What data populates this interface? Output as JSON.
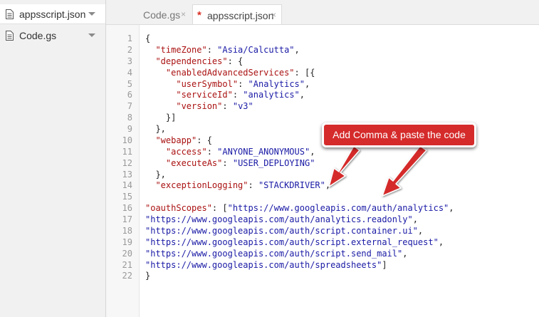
{
  "sidebar": {
    "items": [
      {
        "label": "appsscript.json",
        "icon": "file-icon"
      },
      {
        "label": "Code.gs",
        "icon": "file-icon"
      }
    ]
  },
  "tabs": [
    {
      "label": "Code.gs",
      "close": "×"
    },
    {
      "label": "appsscript.json",
      "close": "×",
      "modified_marker": "*"
    }
  ],
  "editor": {
    "lines": [
      {
        "n": "1",
        "segments": [
          {
            "t": "{",
            "c": "p"
          }
        ]
      },
      {
        "n": "2",
        "segments": [
          {
            "t": "  ",
            "c": "p"
          },
          {
            "t": "\"timeZone\"",
            "c": "k"
          },
          {
            "t": ": ",
            "c": "p"
          },
          {
            "t": "\"Asia/Calcutta\"",
            "c": "s"
          },
          {
            "t": ",",
            "c": "p"
          }
        ]
      },
      {
        "n": "3",
        "segments": [
          {
            "t": "  ",
            "c": "p"
          },
          {
            "t": "\"dependencies\"",
            "c": "k"
          },
          {
            "t": ": {",
            "c": "p"
          }
        ]
      },
      {
        "n": "4",
        "segments": [
          {
            "t": "    ",
            "c": "p"
          },
          {
            "t": "\"enabledAdvancedServices\"",
            "c": "k"
          },
          {
            "t": ": [{",
            "c": "p"
          }
        ]
      },
      {
        "n": "5",
        "segments": [
          {
            "t": "      ",
            "c": "p"
          },
          {
            "t": "\"userSymbol\"",
            "c": "k"
          },
          {
            "t": ": ",
            "c": "p"
          },
          {
            "t": "\"Analytics\"",
            "c": "s"
          },
          {
            "t": ",",
            "c": "p"
          }
        ]
      },
      {
        "n": "6",
        "segments": [
          {
            "t": "      ",
            "c": "p"
          },
          {
            "t": "\"serviceId\"",
            "c": "k"
          },
          {
            "t": ": ",
            "c": "p"
          },
          {
            "t": "\"analytics\"",
            "c": "s"
          },
          {
            "t": ",",
            "c": "p"
          }
        ]
      },
      {
        "n": "7",
        "segments": [
          {
            "t": "      ",
            "c": "p"
          },
          {
            "t": "\"version\"",
            "c": "k"
          },
          {
            "t": ": ",
            "c": "p"
          },
          {
            "t": "\"v3\"",
            "c": "s"
          }
        ]
      },
      {
        "n": "8",
        "segments": [
          {
            "t": "    }]",
            "c": "p"
          }
        ]
      },
      {
        "n": "9",
        "segments": [
          {
            "t": "  },",
            "c": "p"
          }
        ]
      },
      {
        "n": "10",
        "segments": [
          {
            "t": "  ",
            "c": "p"
          },
          {
            "t": "\"webapp\"",
            "c": "k"
          },
          {
            "t": ": {",
            "c": "p"
          }
        ]
      },
      {
        "n": "11",
        "segments": [
          {
            "t": "    ",
            "c": "p"
          },
          {
            "t": "\"access\"",
            "c": "k"
          },
          {
            "t": ": ",
            "c": "p"
          },
          {
            "t": "\"ANYONE_ANONYMOUS\"",
            "c": "s"
          },
          {
            "t": ",",
            "c": "p"
          }
        ]
      },
      {
        "n": "12",
        "segments": [
          {
            "t": "    ",
            "c": "p"
          },
          {
            "t": "\"executeAs\"",
            "c": "k"
          },
          {
            "t": ": ",
            "c": "p"
          },
          {
            "t": "\"USER_DEPLOYING\"",
            "c": "s"
          }
        ]
      },
      {
        "n": "13",
        "segments": [
          {
            "t": "  },",
            "c": "p"
          }
        ]
      },
      {
        "n": "14",
        "segments": [
          {
            "t": "  ",
            "c": "p"
          },
          {
            "t": "\"exceptionLogging\"",
            "c": "k"
          },
          {
            "t": ": ",
            "c": "p"
          },
          {
            "t": "\"STACKDRIVER\"",
            "c": "s"
          },
          {
            "t": ",",
            "c": "p"
          }
        ]
      },
      {
        "n": "15",
        "segments": []
      },
      {
        "n": "16",
        "segments": [
          {
            "t": "\"oauthScopes\"",
            "c": "k"
          },
          {
            "t": ": [",
            "c": "p"
          },
          {
            "t": "\"https://www.googleapis.com/auth/analytics\"",
            "c": "s"
          },
          {
            "t": ",",
            "c": "p"
          }
        ]
      },
      {
        "n": "17",
        "segments": [
          {
            "t": "\"https://www.googleapis.com/auth/analytics.readonly\"",
            "c": "s"
          },
          {
            "t": ",",
            "c": "p"
          }
        ]
      },
      {
        "n": "18",
        "segments": [
          {
            "t": "\"https://www.googleapis.com/auth/script.container.ui\"",
            "c": "s"
          },
          {
            "t": ",",
            "c": "p"
          }
        ]
      },
      {
        "n": "19",
        "segments": [
          {
            "t": "\"https://www.googleapis.com/auth/script.external_request\"",
            "c": "s"
          },
          {
            "t": ",",
            "c": "p"
          }
        ]
      },
      {
        "n": "20",
        "segments": [
          {
            "t": "\"https://www.googleapis.com/auth/script.send_mail\"",
            "c": "s"
          },
          {
            "t": ",",
            "c": "p"
          }
        ]
      },
      {
        "n": "21",
        "segments": [
          {
            "t": "\"https://www.googleapis.com/auth/spreadsheets\"",
            "c": "s"
          },
          {
            "t": "]",
            "c": "p"
          }
        ]
      },
      {
        "n": "22",
        "segments": [
          {
            "t": "}",
            "c": "p"
          }
        ]
      }
    ]
  },
  "annotation": {
    "text": "Add Comma & paste the code",
    "color": "#d52b2b"
  }
}
